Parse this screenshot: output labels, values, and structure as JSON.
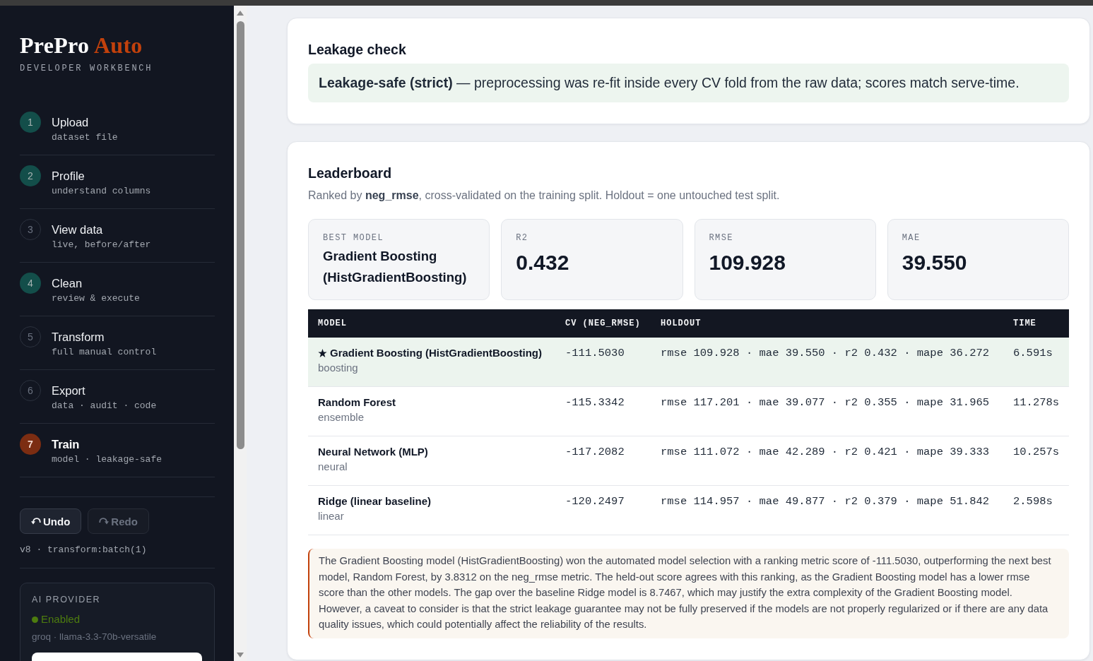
{
  "sidebar": {
    "logo": {
      "name": "PrePro",
      "accent": "Auto"
    },
    "tagline": "DEVELOPER WORKBENCH",
    "steps": [
      {
        "number": "1",
        "title": "Upload",
        "subtitle": "dataset file",
        "done": true,
        "selected": false
      },
      {
        "number": "2",
        "title": "Profile",
        "subtitle": "understand columns",
        "done": true,
        "selected": false
      },
      {
        "number": "3",
        "title": "View data",
        "subtitle": "live, before/after",
        "done": false,
        "selected": false
      },
      {
        "number": "4",
        "title": "Clean",
        "subtitle": "review & execute",
        "done": true,
        "selected": false
      },
      {
        "number": "5",
        "title": "Transform",
        "subtitle": "full manual control",
        "done": false,
        "selected": false
      },
      {
        "number": "6",
        "title": "Export",
        "subtitle": "data · audit · code",
        "done": false,
        "selected": false
      },
      {
        "number": "7",
        "title": "Train",
        "subtitle": "model · leakage-safe",
        "done": false,
        "selected": true
      }
    ],
    "history": {
      "buttons": [
        {
          "kind": "undo",
          "label": "Undo",
          "disabled": false
        },
        {
          "kind": "redo",
          "label": "Redo",
          "disabled": true
        }
      ],
      "version": "v8 · transform:batch(1)"
    },
    "ai_provider": {
      "heading": "AI PROVIDER",
      "enabled": true,
      "status": "Enabled",
      "model": "groq · llama-3.3-70b-versatile"
    }
  },
  "leakage_check": {
    "title": "Leakage check",
    "safe": true,
    "message": "**Leakage-safe (strict)** — preprocessing was re-fit inside every CV fold from the raw data; scores match serve-time."
  },
  "leaderboard": {
    "title": "Leaderboard",
    "subtitle": "Ranked by **neg_rmse**, cross-validated on the training split. Holdout = one untouched test split.",
    "metrics": [
      {
        "kind": "text",
        "label": "BEST MODEL",
        "value": "Gradient Boosting (HistGradientBoosting)"
      },
      {
        "kind": "number",
        "label": "R2",
        "value": "0.432"
      },
      {
        "kind": "number",
        "label": "RMSE",
        "value": "109.928"
      },
      {
        "kind": "number",
        "label": "MAE",
        "value": "39.550"
      }
    ],
    "table": {
      "columns": [
        "MODEL",
        "CV (NEG_RMSE)",
        "HOLDOUT",
        "TIME"
      ],
      "rows": [
        {
          "best": true,
          "model": "Gradient Boosting (HistGradientBoosting)",
          "category": "boosting",
          "cv": "-111.5030",
          "holdout": "rmse 109.928 · mae 39.550 · r2 0.432 · mape 36.272",
          "time": "6.591s"
        },
        {
          "best": false,
          "model": "Random Forest",
          "category": "ensemble",
          "cv": "-115.3342",
          "holdout": "rmse 117.201 · mae 39.077 · r2 0.355 · mape 31.965",
          "time": "11.278s"
        },
        {
          "best": false,
          "model": "Neural Network (MLP)",
          "category": "neural",
          "cv": "-117.2082",
          "holdout": "rmse 111.072 · mae 42.289 · r2 0.421 · mape 39.333",
          "time": "10.257s"
        },
        {
          "best": false,
          "model": "Ridge (linear baseline)",
          "category": "linear",
          "cv": "-120.2497",
          "holdout": "rmse 114.957 · mae 49.877 · r2 0.379 · mape 51.842",
          "time": "2.598s"
        }
      ]
    },
    "summary": "The Gradient Boosting model (HistGradientBoosting) won the automated model selection with a ranking metric score of -111.5030, outperforming the next best model, Random Forest, by 3.8312 on the neg_rmse metric. The held-out score agrees with this ranking, as the Gradient Boosting model has a lower rmse score than the other models. The gap over the baseline Ridge model is 8.7467, which may justify the extra complexity of the Gradient Boosting model. However, a caveat to consider is that the strict leakage guarantee may not be fully preserved if the models are not properly regularized or if there are any data quality issues, which could potentially affect the reliability of the results."
  }
}
